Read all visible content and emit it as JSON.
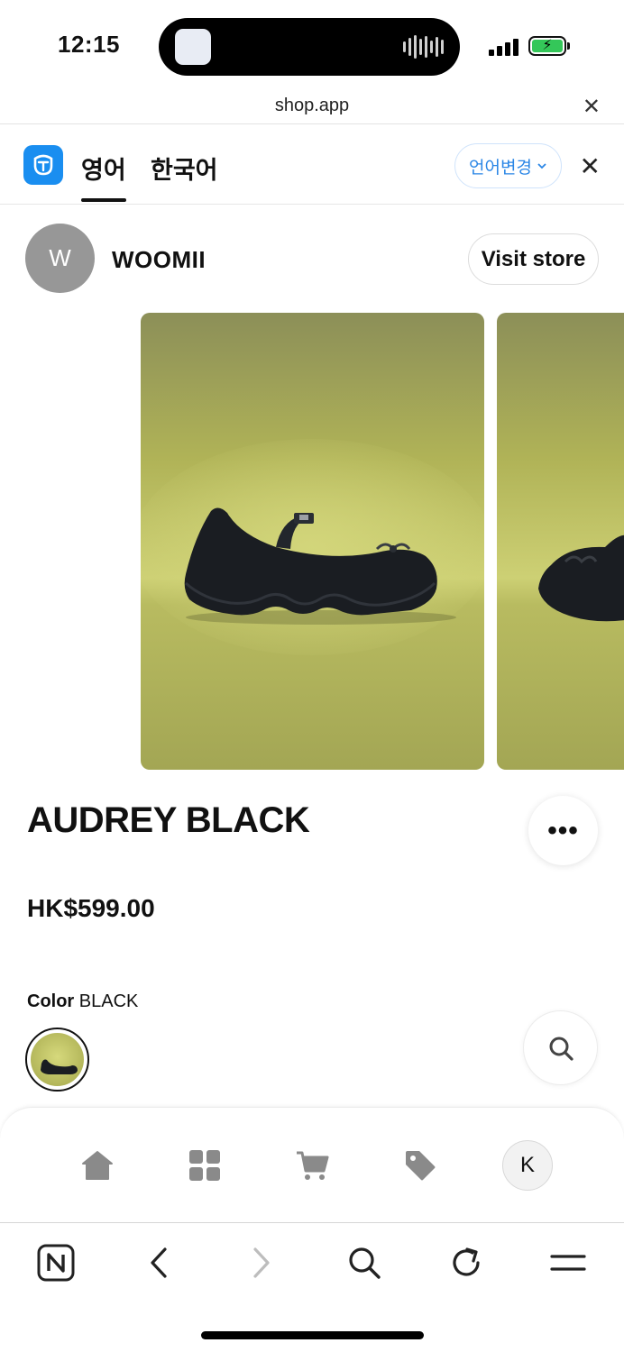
{
  "status_bar": {
    "time": "12:15",
    "battery_state": "charging",
    "signal_bars": 4
  },
  "browser": {
    "url": "shop.app"
  },
  "translation_bar": {
    "tabs": [
      {
        "label": "영어",
        "active": true
      },
      {
        "label": "한국어",
        "active": false
      }
    ],
    "change_language_label": "언어변경",
    "accent_color": "#2a86e6"
  },
  "store": {
    "avatar_initial": "W",
    "name": "WOOMII",
    "visit_label": "Visit store"
  },
  "product": {
    "title": "AUDREY BLACK",
    "price": "HK$599.00",
    "more_label": "•••",
    "color_label": "Color",
    "color_value": "BLACK",
    "image_background": "#b9bc5e"
  },
  "shop_nav": {
    "items": [
      "home-icon",
      "grid-icon",
      "cart-icon",
      "tag-icon",
      "profile-avatar"
    ],
    "profile_initial": "K"
  },
  "browser_toolbar": {
    "items": [
      "naver-icon",
      "back-icon",
      "forward-icon",
      "search-icon",
      "reload-icon",
      "menu-icon"
    ]
  }
}
